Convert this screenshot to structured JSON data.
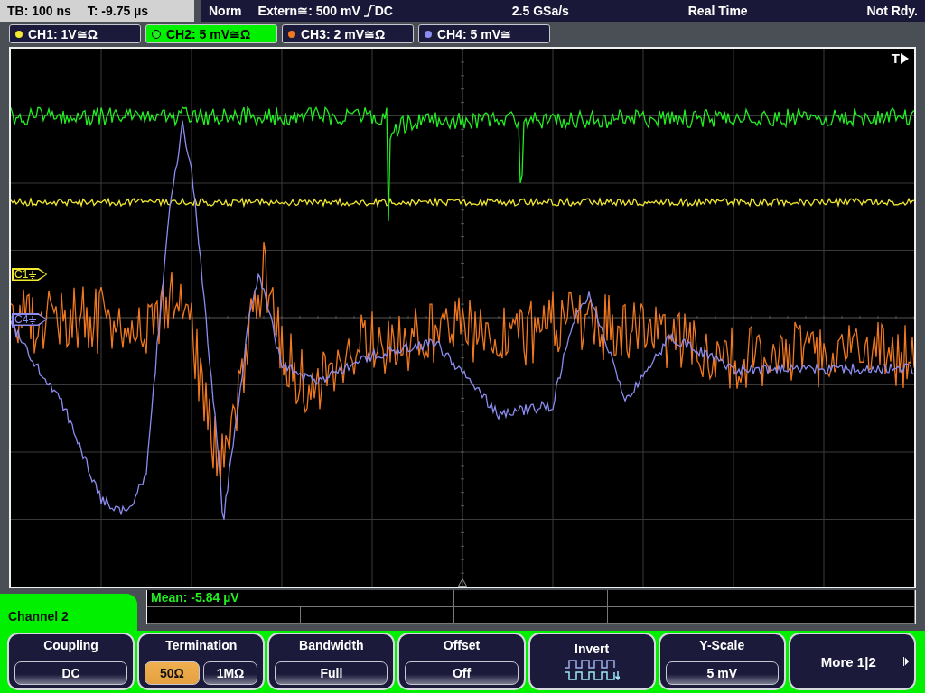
{
  "status_bar": {
    "timebase": "TB: 100 ns",
    "trigger_time": "T: -9.75 µs",
    "mode": "Norm",
    "trigger_source": "Extern≅: 500 mV",
    "trigger_coupling": "DC",
    "sample_rate": "2.5 GSa/s",
    "acquisition": "Real Time",
    "state": "Not Rdy."
  },
  "channel_tabs": [
    {
      "label": "CH1: 1V≅Ω",
      "color": "#f2e830",
      "selected": false
    },
    {
      "label": "CH2: 5 mV≅Ω",
      "color": "#22ee22",
      "selected": true
    },
    {
      "label": "CH3: 2 mV≅Ω",
      "color": "#f07820",
      "selected": false
    },
    {
      "label": "CH4: 5 mV≅",
      "color": "#8c8cf0",
      "selected": false
    }
  ],
  "plot": {
    "trigger_label": "T",
    "markers": [
      {
        "label": "C1"
      },
      {
        "label": "C4"
      }
    ]
  },
  "measurement": {
    "text": "Mean: -5.84 µV"
  },
  "menu": {
    "title": "Channel 2"
  },
  "softkeys": [
    {
      "kind": "value",
      "title": "Coupling",
      "value": "DC"
    },
    {
      "kind": "options",
      "title": "Termination",
      "options": [
        {
          "label": "50Ω",
          "selected": true
        },
        {
          "label": "1MΩ",
          "selected": false
        }
      ]
    },
    {
      "kind": "value",
      "title": "Bandwidth",
      "value": "Full"
    },
    {
      "kind": "value",
      "title": "Offset",
      "value": "Off"
    },
    {
      "kind": "icon",
      "title": "Invert"
    },
    {
      "kind": "value",
      "title": "Y-Scale",
      "value": "5 mV"
    },
    {
      "kind": "more",
      "title": "More 1|2"
    }
  ]
}
